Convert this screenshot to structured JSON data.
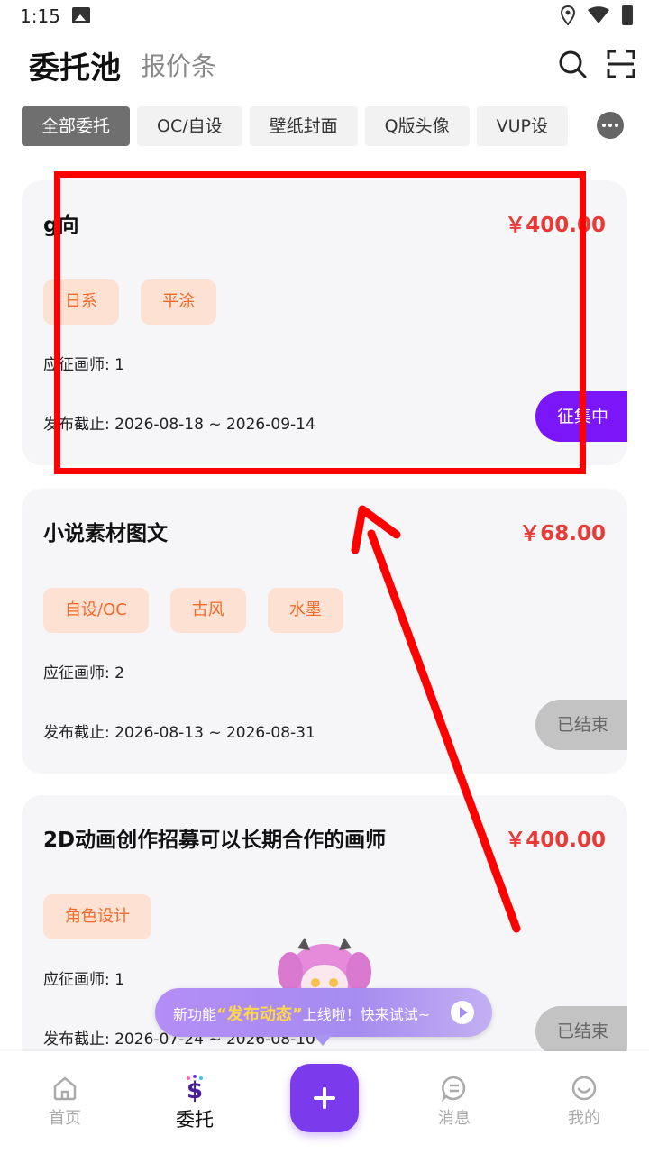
{
  "status_bar": {
    "time": "1:15"
  },
  "header": {
    "title": "委托池",
    "subtitle": "报价条"
  },
  "tabs": [
    {
      "label": "全部委托",
      "active": true
    },
    {
      "label": "OC/自设",
      "active": false
    },
    {
      "label": "壁纸封面",
      "active": false
    },
    {
      "label": "Q版头像",
      "active": false
    },
    {
      "label": "VUP设",
      "active": false
    }
  ],
  "cards": [
    {
      "title": "g向",
      "price": "￥400.00",
      "tags": [
        "日系",
        "平涂"
      ],
      "count": "应征画师: 1",
      "date": "发布截止: 2026-08-18 ~ 2026-09-14",
      "status": "征集中"
    },
    {
      "title": "小说素材图文",
      "price": "￥68.00",
      "tags": [
        "自设/OC",
        "古风",
        "水墨"
      ],
      "count": "应征画师: 2",
      "date": "发布截止: 2026-08-13 ~ 2026-08-31",
      "status": "已结束"
    },
    {
      "title": "2D动画创作招募可以长期合作的画师",
      "price": "￥400.00",
      "tags": [
        "角色设计"
      ],
      "count": "应征画师: 1",
      "date": "发布截止: 2026-07-24 ~ 2026-08-10",
      "status": "已结束"
    }
  ],
  "promo": {
    "prefix": "新功能",
    "highlight": "“发布动态”",
    "suffix": "上线啦！快来试试~"
  },
  "bottom_nav": {
    "home": "首页",
    "commission": "委托",
    "messages": "消息",
    "mine": "我的"
  },
  "colors": {
    "accent": "#7c3aed",
    "price": "#e83a36",
    "tag_bg": "#fde1d2",
    "tag_text": "#f26a2b",
    "annotation": "#ff0000"
  }
}
